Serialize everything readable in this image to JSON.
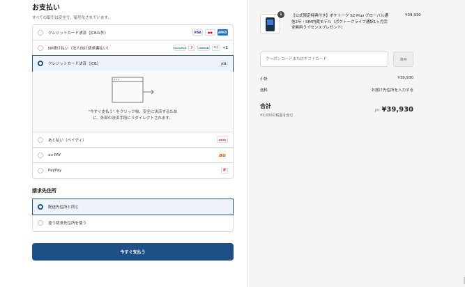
{
  "payment": {
    "title": "お支払い",
    "subtitle": "すべての取引は安全で、暗号化されています。",
    "methods": [
      {
        "label": "クレジットカード決済（JCB以外）",
        "logos": [
          "VISA",
          "●●",
          "AMEX"
        ]
      },
      {
        "label": "NP掛け払い（法人向け請求書払い）",
        "logos": [
          "FamilyMart",
          "7",
          "LAWSON",
          "ミニ",
          "+2"
        ]
      },
      {
        "label": "クレジットカード決済（JCB）",
        "logos": [
          "JCB"
        ]
      },
      {
        "label": "あと払い（ペイディ）",
        "logos": [
          "paidy"
        ]
      },
      {
        "label": "au PAY",
        "logos": [
          "au"
        ]
      },
      {
        "label": "PayPay",
        "logos": [
          "P"
        ]
      }
    ],
    "redirect_text_line1": "\"今すぐ支払う\" をクリック後、安全に決済するため",
    "redirect_text_line2": "に、外部の決済手段にリダイレクトされます。"
  },
  "billing": {
    "title": "請求先住所",
    "options": [
      {
        "label": "配送先住所と同じ"
      },
      {
        "label": "違う請求先住所を使う"
      }
    ]
  },
  "pay_button": "今すぐ支払う",
  "order": {
    "item": {
      "quantity": "1",
      "name": "【公式限定特典付き】ポケトーク S2 Plus グローバル通信2年・SIM内蔵モデル（ポケトークライブ通訳1ヶ月完全無料ライセンスプレゼント）",
      "price": "¥39,930"
    },
    "coupon_placeholder": "クーポンコードまたはギフトカード",
    "apply_label": "適用",
    "subtotal_label": "小計",
    "subtotal_value": "¥39,930",
    "shipping_label": "送料",
    "shipping_value": "お届け先住所を入力する",
    "total_label": "合計",
    "total_currency": "JPY",
    "total_value": "¥39,930",
    "tax_note": "¥3,630の税金を含む"
  },
  "colors": {
    "accent": "#1e4f87",
    "selected_bg": "#eef3f9",
    "summary_bg": "#f5f5f5"
  }
}
